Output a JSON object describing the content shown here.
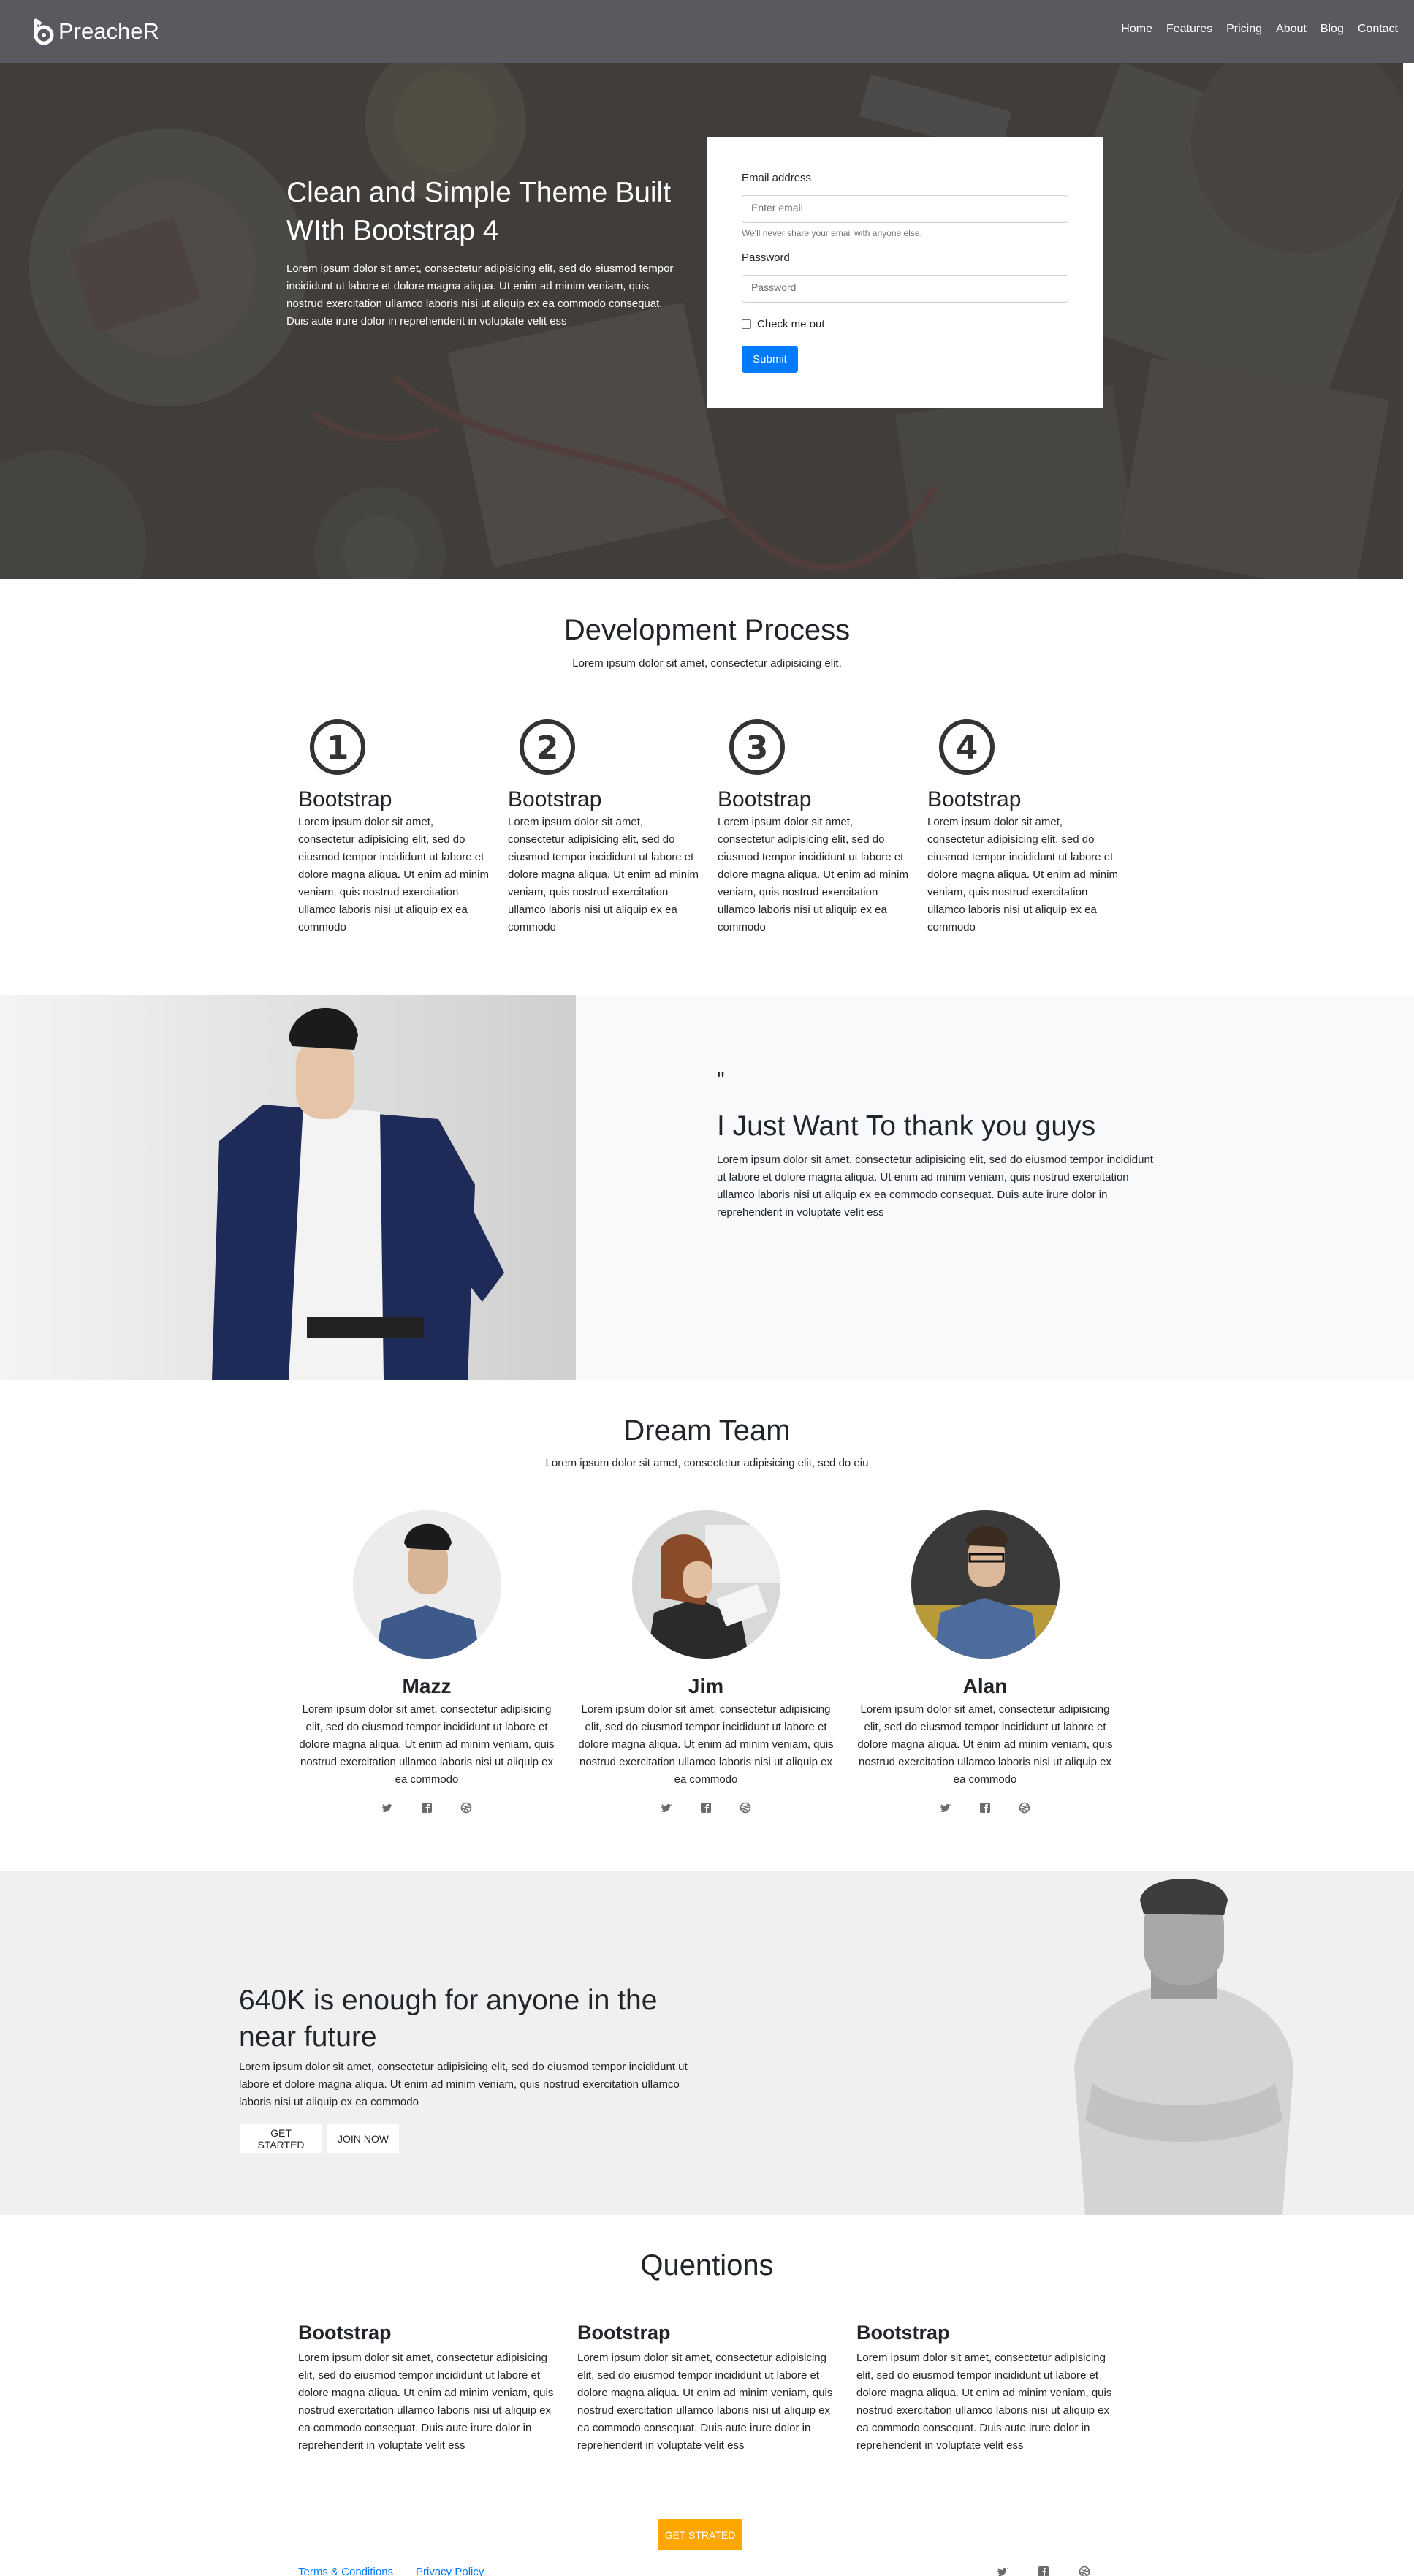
{
  "nav": {
    "brand": "PreacheR",
    "links": [
      "Home",
      "Features",
      "Pricing",
      "About",
      "Blog",
      "Contact"
    ]
  },
  "hero": {
    "title": "Clean and Simple Theme Built WIth Bootstrap 4",
    "text": "Lorem ipsum dolor sit amet, consectetur adipisicing elit, sed do eiusmod tempor incididunt ut labore et dolore magna aliqua. Ut enim ad minim veniam, quis nostrud exercitation ullamco laboris nisi ut aliquip ex ea commodo consequat. Duis aute irure dolor in reprehenderit in voluptate velit ess",
    "form": {
      "email_label": "Email address",
      "email_placeholder": "Enter email",
      "email_help": "We'll never share your email with anyone else.",
      "password_label": "Password",
      "password_placeholder": "Password",
      "checkbox_label": "Check me out",
      "submit_label": "Submit"
    }
  },
  "process": {
    "title": "Development Process",
    "subtitle": "Lorem ipsum dolor sit amet, consectetur adipisicing elit,",
    "steps": [
      {
        "number": "1",
        "title": "Bootstrap",
        "text": "Lorem ipsum dolor sit amet, consectetur adipisicing elit, sed do eiusmod tempor incididunt ut labore et dolore magna aliqua. Ut enim ad minim veniam, quis nostrud exercitation ullamco laboris nisi ut aliquip ex ea commodo"
      },
      {
        "number": "2",
        "title": "Bootstrap",
        "text": "Lorem ipsum dolor sit amet, consectetur adipisicing elit, sed do eiusmod tempor incididunt ut labore et dolore magna aliqua. Ut enim ad minim veniam, quis nostrud exercitation ullamco laboris nisi ut aliquip ex ea commodo"
      },
      {
        "number": "3",
        "title": "Bootstrap",
        "text": "Lorem ipsum dolor sit amet, consectetur adipisicing elit, sed do eiusmod tempor incididunt ut labore et dolore magna aliqua. Ut enim ad minim veniam, quis nostrud exercitation ullamco laboris nisi ut aliquip ex ea commodo"
      },
      {
        "number": "4",
        "title": "Bootstrap",
        "text": "Lorem ipsum dolor sit amet, consectetur adipisicing elit, sed do eiusmod tempor incididunt ut labore et dolore magna aliqua. Ut enim ad minim veniam, quis nostrud exercitation ullamco laboris nisi ut aliquip ex ea commodo"
      }
    ]
  },
  "testimonial": {
    "quote_mark": "\"",
    "title": "I Just Want To thank you guys",
    "text": "Lorem ipsum dolor sit amet, consectetur adipisicing elit, sed do eiusmod tempor incididunt ut labore et dolore magna aliqua. Ut enim ad minim veniam, quis nostrud exercitation ullamco laboris nisi ut aliquip ex ea commodo consequat. Duis aute irure dolor in reprehenderit in voluptate velit ess"
  },
  "team": {
    "title": "Dream Team",
    "subtitle": "Lorem ipsum dolor sit amet, consectetur adipisicing elit, sed do eiu",
    "members": [
      {
        "name": "Mazz",
        "text": "Lorem ipsum dolor sit amet, consectetur adipisicing elit, sed do eiusmod tempor incididunt ut labore et dolore magna aliqua. Ut enim ad minim veniam, quis nostrud exercitation ullamco laboris nisi ut aliquip ex ea commodo"
      },
      {
        "name": "Jim",
        "text": "Lorem ipsum dolor sit amet, consectetur adipisicing elit, sed do eiusmod tempor incididunt ut labore et dolore magna aliqua. Ut enim ad minim veniam, quis nostrud exercitation ullamco laboris nisi ut aliquip ex ea commodo"
      },
      {
        "name": "Alan",
        "text": "Lorem ipsum dolor sit amet, consectetur adipisicing elit, sed do eiusmod tempor incididunt ut labore et dolore magna aliqua. Ut enim ad minim veniam, quis nostrud exercitation ullamco laboris nisi ut aliquip ex ea commodo"
      }
    ],
    "social_icons": [
      "twitter-icon",
      "facebook-icon",
      "dribbble-icon"
    ]
  },
  "cta": {
    "title": "640K is enough for anyone in the near future",
    "text": "Lorem ipsum dolor sit amet, consectetur adipisicing elit, sed do eiusmod tempor incididunt ut labore et dolore magna aliqua. Ut enim ad minim veniam, quis nostrud exercitation ullamco laboris nisi ut aliquip ex ea commodo",
    "get_started_label": "GET STARTED",
    "join_now_label": "JOIN NOW"
  },
  "questions": {
    "title": "Quentions",
    "items": [
      {
        "title": "Bootstrap",
        "text": "Lorem ipsum dolor sit amet, consectetur adipisicing elit, sed do eiusmod tempor incididunt ut labore et dolore magna aliqua. Ut enim ad minim veniam, quis nostrud exercitation ullamco laboris nisi ut aliquip ex ea commodo consequat. Duis aute irure dolor in reprehenderit in voluptate velit ess"
      },
      {
        "title": "Bootstrap",
        "text": "Lorem ipsum dolor sit amet, consectetur adipisicing elit, sed do eiusmod tempor incididunt ut labore et dolore magna aliqua. Ut enim ad minim veniam, quis nostrud exercitation ullamco laboris nisi ut aliquip ex ea commodo consequat. Duis aute irure dolor in reprehenderit in voluptate velit ess"
      },
      {
        "title": "Bootstrap",
        "text": "Lorem ipsum dolor sit amet, consectetur adipisicing elit, sed do eiusmod tempor incididunt ut labore et dolore magna aliqua. Ut enim ad minim veniam, quis nostrud exercitation ullamco laboris nisi ut aliquip ex ea commodo consequat. Duis aute irure dolor in reprehenderit in voluptate velit ess"
      }
    ],
    "cta_label": "GET STRATED"
  },
  "footer": {
    "terms_label": "Terms & Conditions",
    "privacy_label": "Privacy Policy",
    "social_icons": [
      "twitter-icon",
      "facebook-icon",
      "dribbble-icon"
    ]
  },
  "colors": {
    "navbar": "#5a5960",
    "primary": "#007bff",
    "accent": "#ffa600",
    "light_bg": "#f8f9fa",
    "cta_bg": "#f0f0f0"
  }
}
